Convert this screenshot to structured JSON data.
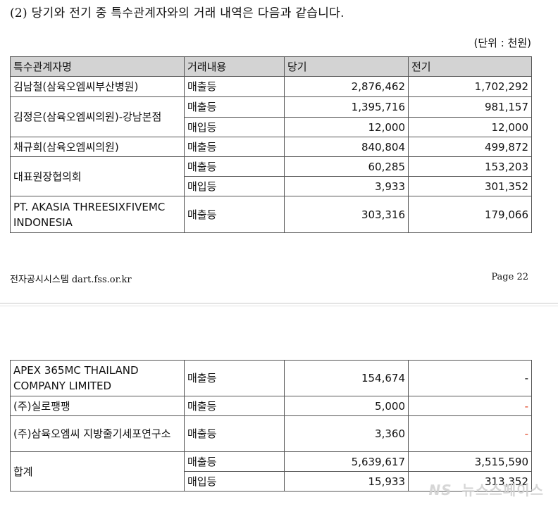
{
  "heading": "(2) 당기와 전기 중 특수관계자와의 거래 내역은 다음과 같습니다.",
  "unit": "(단위 : 천원)",
  "table": {
    "headers": [
      "특수관계자명",
      "거래내용",
      "당기",
      "전기"
    ],
    "rows": [
      {
        "name": "김남철(삼육오엠씨부산병원)",
        "items": [
          {
            "type": "매출등",
            "current": "2,876,462",
            "prior": "1,702,292"
          }
        ]
      },
      {
        "name": "김정은(삼육오엠씨의원)-강남본점",
        "items": [
          {
            "type": "매출등",
            "current": "1,395,716",
            "prior": "981,157"
          },
          {
            "type": "매입등",
            "current": "12,000",
            "prior": "12,000"
          }
        ]
      },
      {
        "name": "채규희(삼육오엠씨의원)",
        "items": [
          {
            "type": "매출등",
            "current": "840,804",
            "prior": "499,872"
          }
        ]
      },
      {
        "name": "대표원장협의회",
        "items": [
          {
            "type": "매출등",
            "current": "60,285",
            "prior": "153,203"
          },
          {
            "type": "매입등",
            "current": "3,933",
            "prior": "301,352"
          }
        ]
      },
      {
        "name": "PT. AKASIA THREESIXFIVEMC INDONESIA",
        "items": [
          {
            "type": "매출등",
            "current": "303,316",
            "prior": "179,066"
          }
        ]
      }
    ]
  },
  "footer": {
    "left": "전자공시시스템 dart.fss.or.kr",
    "right": "Page 22"
  },
  "table2": {
    "rows": [
      {
        "name": "APEX 365MC THAILAND COMPANY LIMITED",
        "type": "매출등",
        "current": "154,674",
        "prior": "-"
      },
      {
        "name": "(주)실로팽팽",
        "type": "매출등",
        "current": "5,000",
        "prior": "-"
      },
      {
        "name": "(주)삼육오엠씨 지방줄기세포연구소",
        "type": "매출등",
        "current": "3,360",
        "prior": "-"
      }
    ],
    "total": {
      "name": "합계",
      "items": [
        {
          "type": "매출등",
          "current": "5,639,617",
          "prior": "3,515,590"
        },
        {
          "type": "매입등",
          "current": "15,933",
          "prior": "313,352"
        }
      ]
    }
  },
  "watermark": {
    "logo": "NS",
    "text": "뉴스스페이스"
  }
}
